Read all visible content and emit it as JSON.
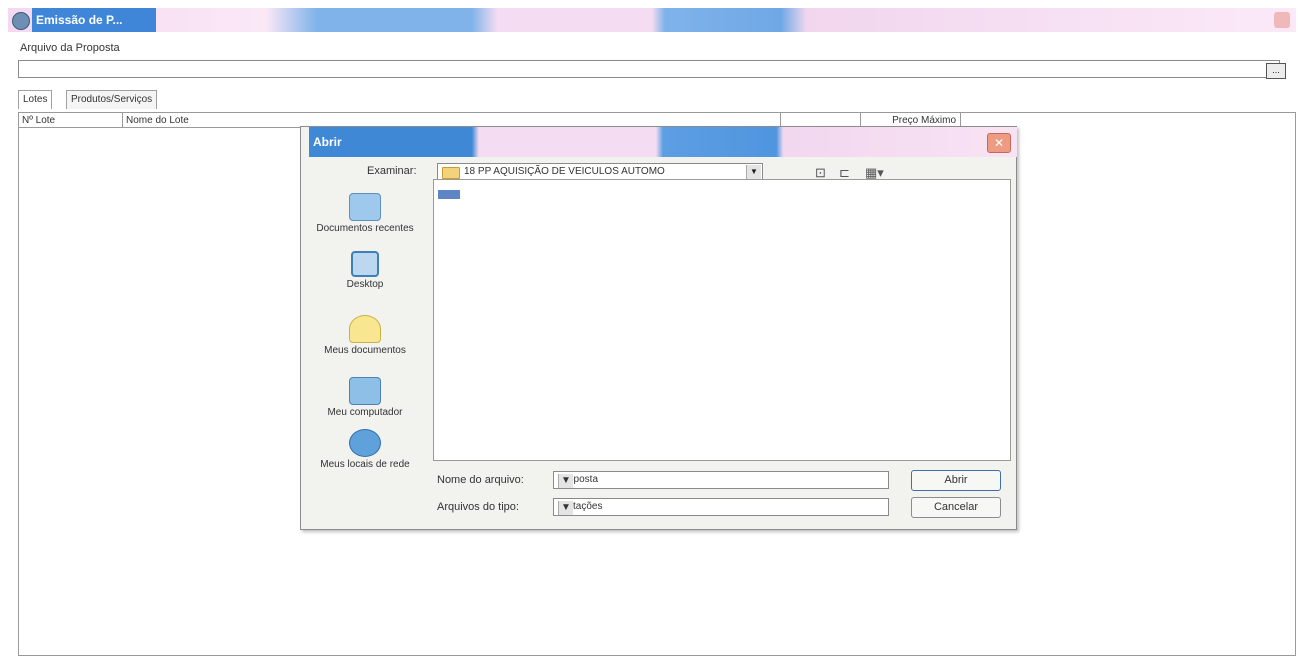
{
  "window": {
    "title": "Emissão de P..."
  },
  "proposal": {
    "label": "Arquivo da Proposta",
    "value": "",
    "browse_label": "..."
  },
  "tabs": [
    {
      "label": "Lotes"
    },
    {
      "label": "Produtos/Serviços"
    }
  ],
  "grid": {
    "columns": [
      {
        "label": "Nº Lote"
      },
      {
        "label": "Nome do Lote"
      },
      {
        "label": ""
      },
      {
        "label": "Preço Máximo"
      }
    ]
  },
  "dialog": {
    "title": "Abrir",
    "close_label": "✕",
    "look_in_label": "Examinar:",
    "look_in_value": "18 PP AQUISIÇÃO DE VEICULOS AUTOMO",
    "toolbar_icons": [
      "up-folder-icon",
      "new-folder-icon",
      "view-menu-icon"
    ],
    "places": [
      {
        "label": "Documentos recentes",
        "icon": "recent-documents-icon"
      },
      {
        "label": "Desktop",
        "icon": "desktop-icon"
      },
      {
        "label": "Meus documentos",
        "icon": "my-documents-icon"
      },
      {
        "label": "Meu computador",
        "icon": "my-computer-icon"
      },
      {
        "label": "Meus locais de rede",
        "icon": "network-places-icon"
      }
    ],
    "file_list": [
      {
        "name": "",
        "icon": "file-icon"
      }
    ],
    "filename_label": "Nome do arquivo:",
    "filename_value": "Proposta",
    "filetype_label": "Arquivos do tipo:",
    "filetype_value": "Licitações",
    "open_button": "Abrir",
    "cancel_button": "Cancelar"
  }
}
